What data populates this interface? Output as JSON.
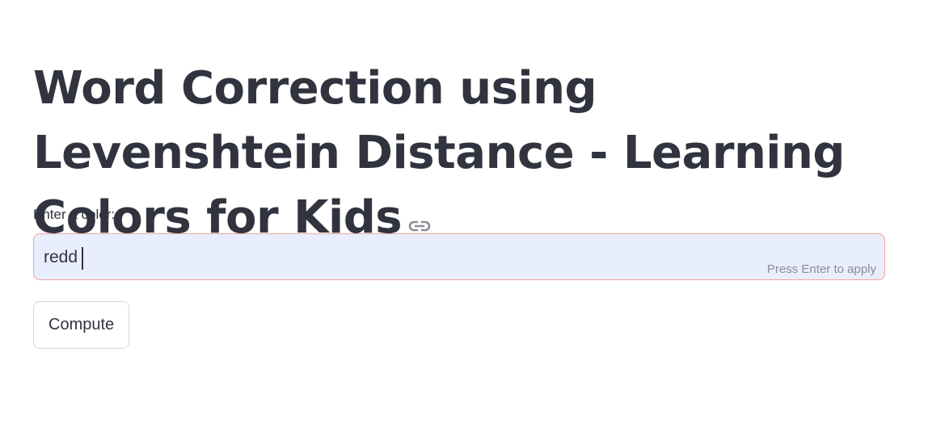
{
  "header": {
    "title": "Word Correction using Levenshtein Distance - Learning Colors for Kids",
    "anchor_icon": "link-icon"
  },
  "form": {
    "label": "Enter a color:",
    "input_value": "redd",
    "hint": "Press Enter to apply"
  },
  "actions": {
    "compute_label": "Compute"
  },
  "colors": {
    "text": "#31333f",
    "input_bg": "#e8eefc",
    "input_border_focus": "#f4a39a",
    "hint": "#8a8d97",
    "button_border": "#d6d6d9"
  }
}
